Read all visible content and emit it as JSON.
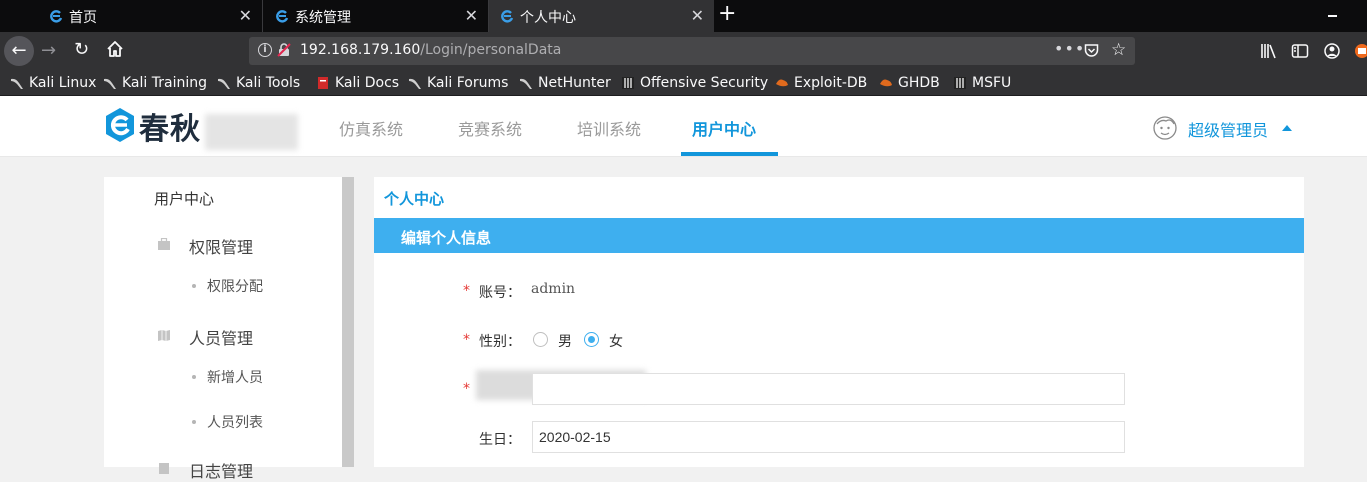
{
  "browser": {
    "tabs": [
      {
        "title": "首页",
        "close": "✕"
      },
      {
        "title": "系统管理",
        "close": "✕"
      },
      {
        "title": "个人中心",
        "close": "✕"
      }
    ],
    "new_tab": "+",
    "url": {
      "host": "192.168.179.160",
      "path": "/Login/personalData"
    },
    "url_more": "•••",
    "bookmarks": [
      {
        "label": "Kali Linux",
        "icon": "kali-dragon-icon"
      },
      {
        "label": "Kali Training",
        "icon": "kali-dragon-icon"
      },
      {
        "label": "Kali Tools",
        "icon": "kali-dragon-icon"
      },
      {
        "label": "Kali Docs",
        "icon": "kali-docs-icon"
      },
      {
        "label": "Kali Forums",
        "icon": "kali-dragon-icon"
      },
      {
        "label": "NetHunter",
        "icon": "kali-dragon-icon"
      },
      {
        "label": "Offensive Security",
        "icon": "offsec-icon"
      },
      {
        "label": "Exploit-DB",
        "icon": "exploitdb-icon"
      },
      {
        "label": "GHDB",
        "icon": "exploitdb-icon"
      },
      {
        "label": "MSFU",
        "icon": "offsec-icon"
      }
    ]
  },
  "header": {
    "logo_text": "春秋",
    "nav": [
      "仿真系统",
      "竞赛系统",
      "培训系统",
      "用户中心"
    ],
    "active_nav": "用户中心",
    "user": "超级管理员",
    "accent": "#1296db"
  },
  "sidebar": {
    "title": "用户中心",
    "groups": [
      {
        "label": "权限管理",
        "icon": "briefcase-icon",
        "items": [
          "权限分配"
        ]
      },
      {
        "label": "人员管理",
        "icon": "map-icon",
        "items": [
          "新增人员",
          "人员列表"
        ]
      },
      {
        "label": "日志管理",
        "icon": "log-icon",
        "items": []
      }
    ]
  },
  "content": {
    "title": "个人中心",
    "section": "编辑个人信息",
    "section_color": "#3eafef",
    "form": {
      "account_label": "账号：",
      "account_value": "admin",
      "gender_label": "性别：",
      "gender_options": [
        "男",
        "女"
      ],
      "gender_selected": "女",
      "required_mark": "*",
      "birthday_label": "生日：",
      "birthday_value": "2020-02-15"
    }
  }
}
